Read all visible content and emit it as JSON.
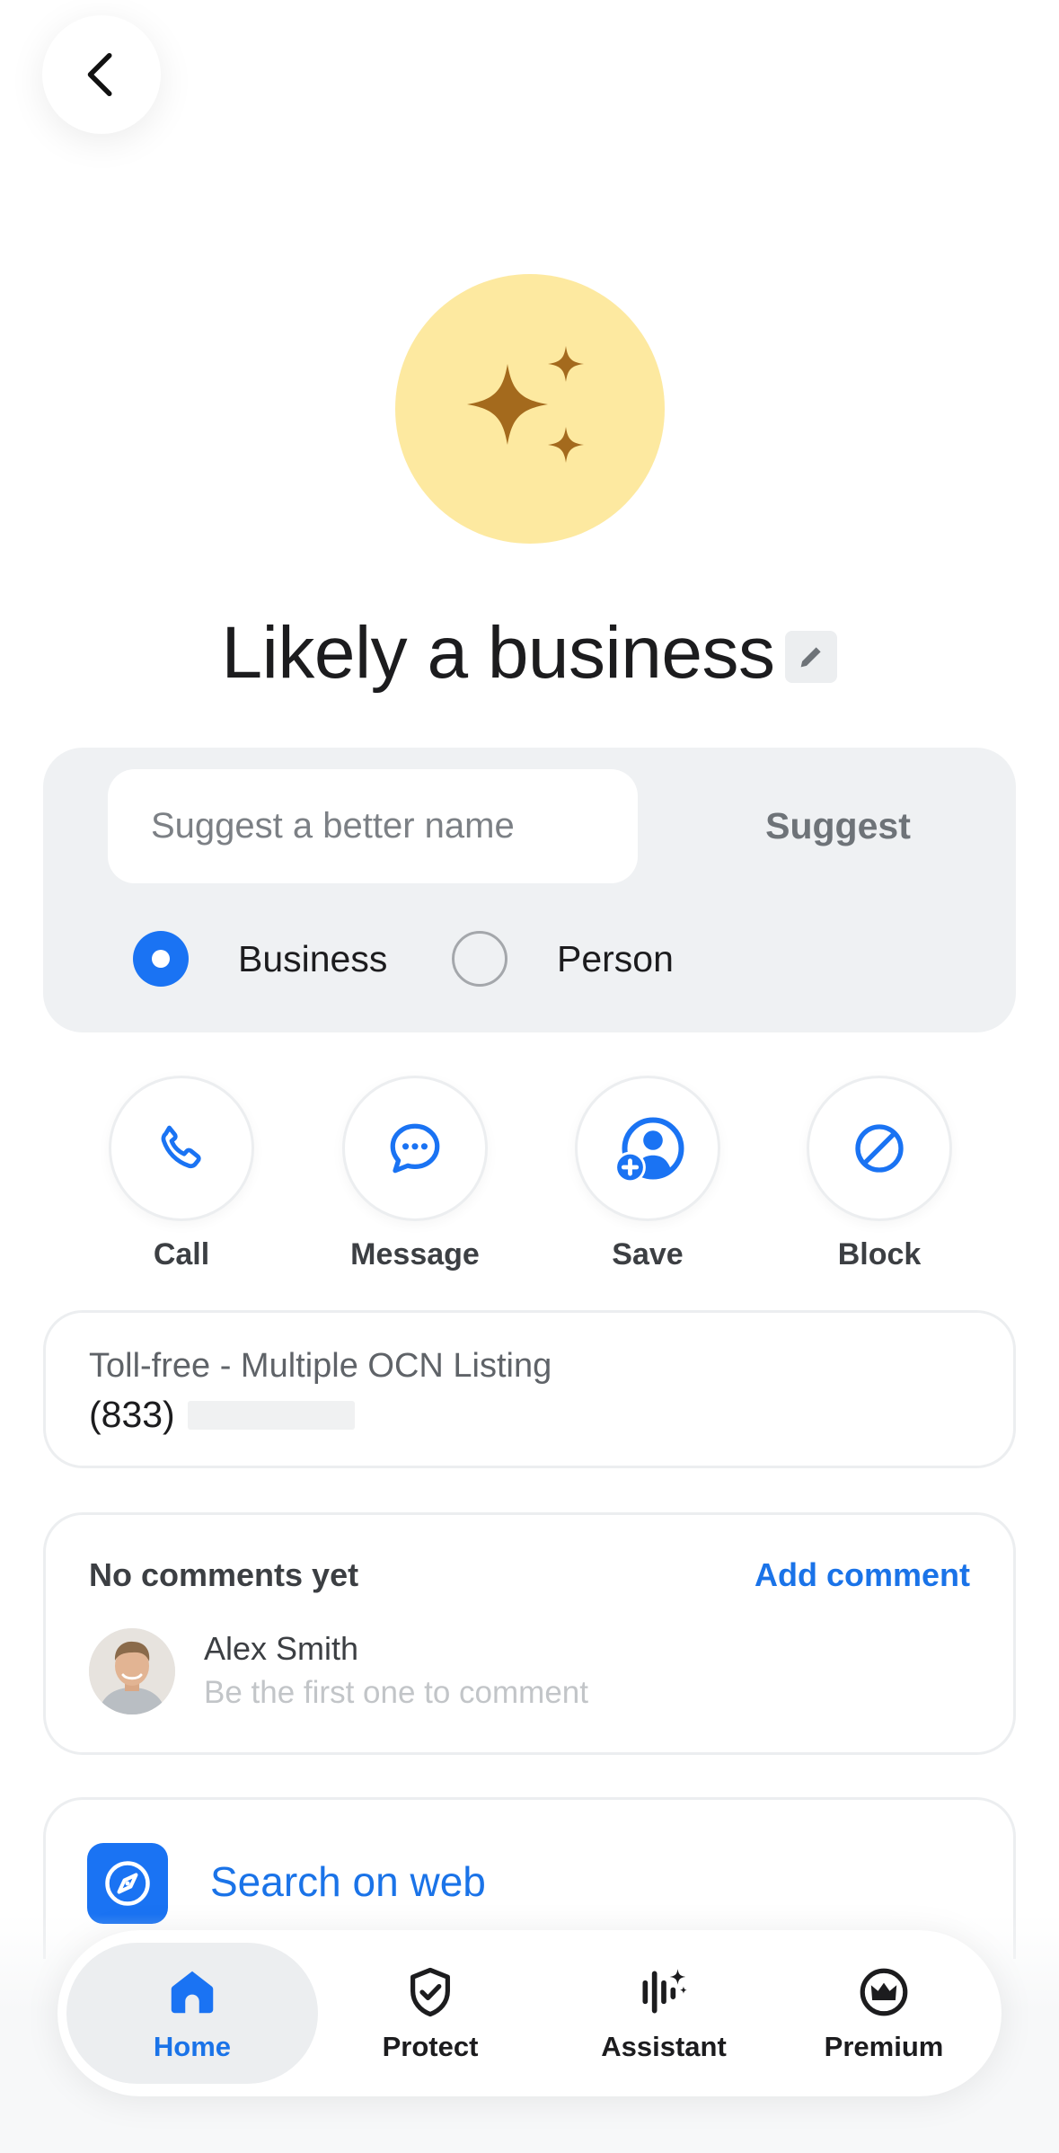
{
  "header": {
    "back_icon": "chevron-left-icon"
  },
  "profile": {
    "avatar_icon": "sparkles-icon",
    "avatar_color": "#fde9a0",
    "icon_color": "#a46a1d",
    "title": "Likely a business",
    "edit_icon": "pencil-icon"
  },
  "suggest": {
    "placeholder": "Suggest a better name",
    "value": "",
    "button_label": "Suggest",
    "options": [
      {
        "label": "Business",
        "selected": true
      },
      {
        "label": "Person",
        "selected": false
      }
    ]
  },
  "actions": [
    {
      "label": "Call",
      "icon": "phone-icon"
    },
    {
      "label": "Message",
      "icon": "chat-bubble-icon"
    },
    {
      "label": "Save",
      "icon": "add-contact-icon"
    },
    {
      "label": "Block",
      "icon": "block-icon"
    }
  ],
  "number_info": {
    "carrier": "Toll-free - Multiple OCN Listing",
    "number_prefix": "(833)"
  },
  "comments": {
    "heading": "No comments yet",
    "add_label": "Add comment",
    "user_name": "Alex Smith",
    "hint": "Be the first one to comment"
  },
  "web_search": {
    "label": "Search on web",
    "icon": "compass-icon"
  },
  "bottom_nav": {
    "items": [
      {
        "label": "Home",
        "icon": "home-icon",
        "active": true
      },
      {
        "label": "Protect",
        "icon": "shield-check-icon",
        "active": false
      },
      {
        "label": "Assistant",
        "icon": "assistant-waveform-icon",
        "active": false
      },
      {
        "label": "Premium",
        "icon": "crown-icon",
        "active": false
      }
    ]
  },
  "colors": {
    "accent": "#1a73f3",
    "link": "#1a73e8"
  }
}
